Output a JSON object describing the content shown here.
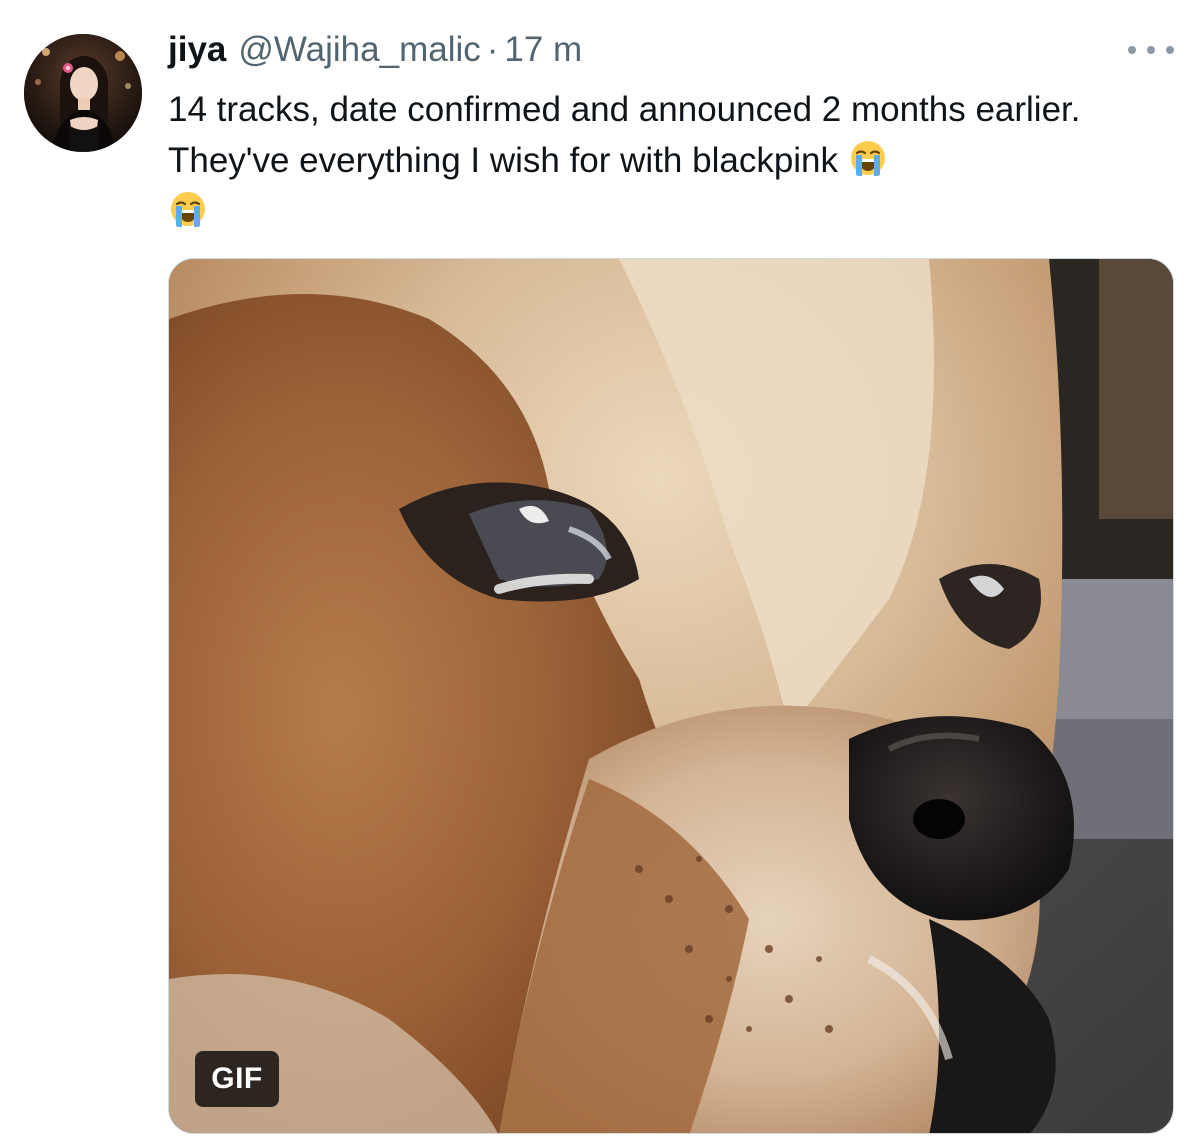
{
  "tweet": {
    "author": {
      "display_name": "jiya",
      "handle": "@Wajiha_malic",
      "separator": "·",
      "timestamp": "17 m"
    },
    "text_line": "14 tracks, date confirmed and announced 2 months earlier. They've everything I wish for with blackpink",
    "emojis": [
      "loudly-crying-face",
      "loudly-crying-face"
    ],
    "media": {
      "type": "gif",
      "badge_label": "GIF",
      "subject": "crying-dog-closeup"
    }
  },
  "colors": {
    "primary_text": "#0f1419",
    "secondary_text": "#536471",
    "more_dots": "#8b98a5",
    "border": "#cfd9de",
    "badge_bg": "#000000c4"
  },
  "icons": {
    "more": "more-horizontal-icon"
  }
}
